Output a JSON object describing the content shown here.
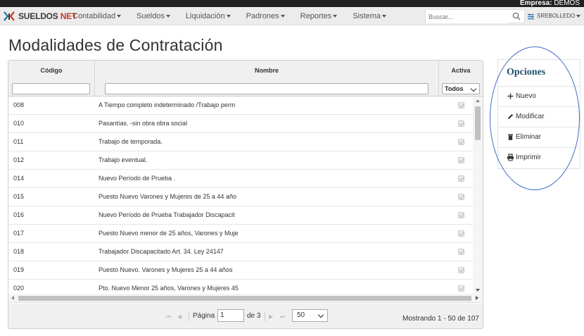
{
  "company": {
    "label": "Empresa:",
    "value": "DEMOS"
  },
  "brand": {
    "part1": "SUELDOS",
    "part2": "NET"
  },
  "nav": {
    "menus": [
      "Contabilidad",
      "Sueldos",
      "Liquidación",
      "Padrones",
      "Reportes",
      "Sistema"
    ],
    "search_placeholder": "Buscar...",
    "user": "SREBOLLEDO"
  },
  "page": {
    "title": "Modalidades de Contratación"
  },
  "grid": {
    "columns": {
      "code": "Código",
      "name": "Nombre",
      "active": "Activa"
    },
    "active_filter": "Todos",
    "rows": [
      {
        "code": "008",
        "name": "A Tiempo completo indeterminado /Trabajo perm"
      },
      {
        "code": "010",
        "name": "Pasantías. -sin obra obra social"
      },
      {
        "code": "011",
        "name": "Trabajo de temporada."
      },
      {
        "code": "012",
        "name": "Trabajo eventual."
      },
      {
        "code": "014",
        "name": "Nuevo Período de Prueba ."
      },
      {
        "code": "015",
        "name": "Puesto Nuevo Varones y Mujeres de 25 a 44 año"
      },
      {
        "code": "016",
        "name": "Nuevo Período de Prueba Trabajador Discapacit"
      },
      {
        "code": "017",
        "name": "Puesto Nuevo menor de 25 años, Varones y Muje"
      },
      {
        "code": "018",
        "name": "Trabajador Discapacitado Art. 34. Ley 24147"
      },
      {
        "code": "019",
        "name": "Puesto Nuevo. Varones y Mujeres 25 a 44 años"
      },
      {
        "code": "020",
        "name": "Pto. Nuevo Menor 25 años, Varones y Mujeres 45"
      }
    ]
  },
  "pager": {
    "page_label": "Página",
    "page_value": "1",
    "of_label": "de 3",
    "page_size": "50",
    "info": "Mostrando 1 - 50 de 107"
  },
  "options": {
    "title": "Opciones",
    "items": [
      "Nuevo",
      "Modificar",
      "Eliminar",
      "Imprimir"
    ]
  },
  "colors": {
    "accent": "#1f4f6b",
    "annotation": "#3f6bc4",
    "brand_red": "#c23b22"
  }
}
